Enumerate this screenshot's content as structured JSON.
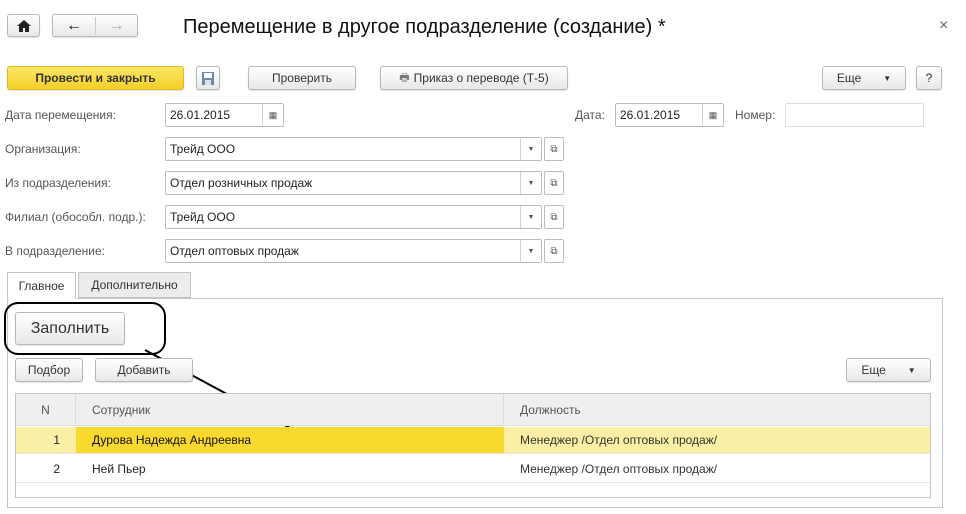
{
  "title": "Перемещение в другое подразделение (создание) *",
  "nav": {
    "home": "home-icon",
    "back": "←",
    "forward": "→",
    "close": "×"
  },
  "toolbar": {
    "post_close": "Провести и закрыть",
    "check": "Проверить",
    "print": "Приказ о переводе (Т-5)",
    "more": "Еще",
    "help": "?"
  },
  "fields": {
    "move_date_label": "Дата перемещения:",
    "move_date": "26.01.2015",
    "date_label": "Дата:",
    "date": "26.01.2015",
    "number_label": "Номер:",
    "number": "",
    "org_label": "Организация:",
    "org": "Трейд ООО",
    "from_label": "Из подразделения:",
    "from": "Отдел розничных продаж",
    "branch_label": "Филиал (обособл. подр.):",
    "branch": "Трейд ООО",
    "to_label": "В подразделение:",
    "to": "Отдел оптовых продаж"
  },
  "tabs": [
    {
      "label": "Главное",
      "active": true
    },
    {
      "label": "Дополнительно",
      "active": false
    }
  ],
  "panel": {
    "fill": "Заполнить",
    "pick": "Подбор",
    "add": "Добавить",
    "more": "Еще"
  },
  "table": {
    "headers": [
      "N",
      "Сотрудник",
      "Должность"
    ],
    "rows": [
      {
        "n": "1",
        "employee": "Дурова Надежда Андреевна",
        "position": "Менеджер /Отдел оптовых продаж/"
      },
      {
        "n": "2",
        "employee": "Ней Пьер",
        "position": "Менеджер /Отдел оптовых продаж/"
      }
    ]
  },
  "colors": {
    "accent": "#f9d92e",
    "row_selected": "#fbefa5"
  }
}
